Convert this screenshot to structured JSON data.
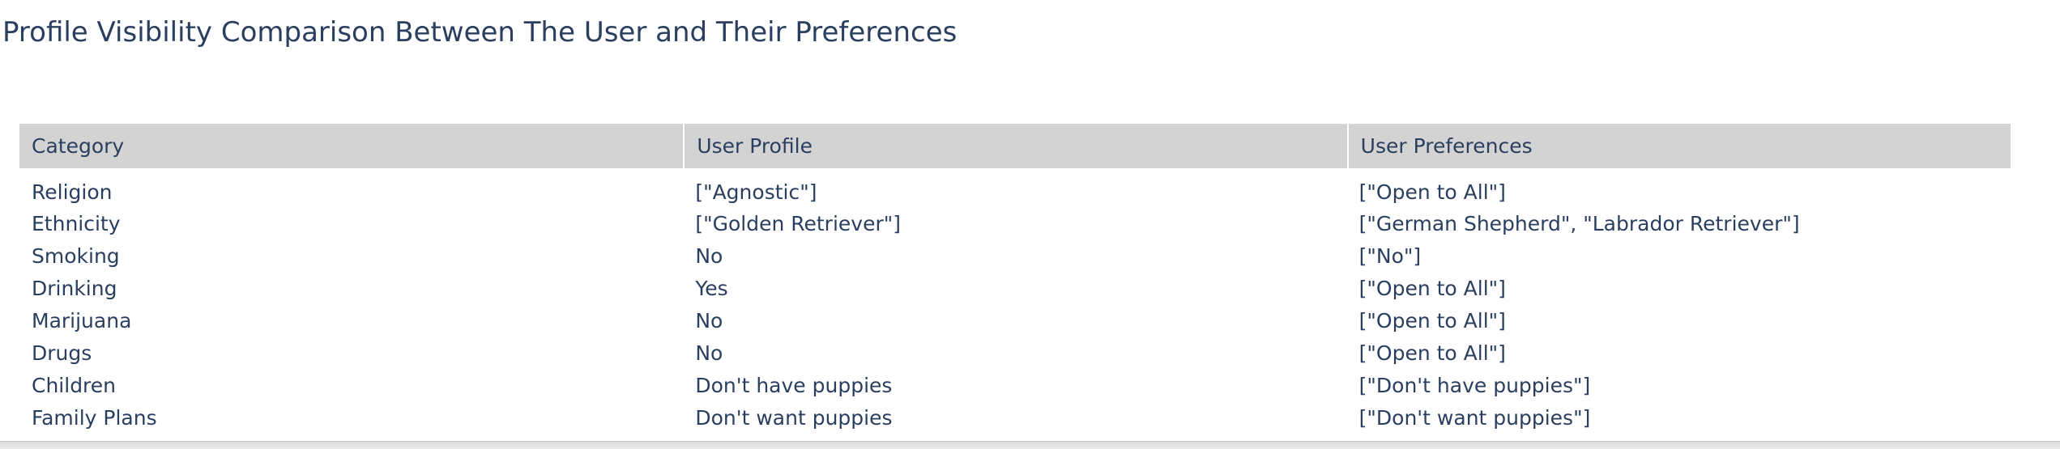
{
  "chart_data": {
    "type": "table",
    "title": "Profile Visibility Comparison Between The User and Their Preferences",
    "columns": [
      "Category",
      "User Profile",
      "User Preferences"
    ],
    "rows": [
      [
        "Religion",
        "[\"Agnostic\"]",
        "[\"Open to All\"]"
      ],
      [
        "Ethnicity",
        "[\"Golden Retriever\"]",
        "[\"German Shepherd\", \"Labrador Retriever\"]"
      ],
      [
        "Smoking",
        "No",
        "[\"No\"]"
      ],
      [
        "Drinking",
        "Yes",
        "[\"Open to All\"]"
      ],
      [
        "Marijuana",
        "No",
        "[\"Open to All\"]"
      ],
      [
        "Drugs",
        "No",
        "[\"Open to All\"]"
      ],
      [
        "Children",
        "Don't have puppies",
        "[\"Don't have puppies\"]"
      ],
      [
        "Family Plans",
        "Don't want puppies",
        "[\"Don't want puppies\"]"
      ]
    ],
    "colors": {
      "header_fill": "#d3d3d3",
      "cell_fill": "#ffffff",
      "text": "#2a3f5f"
    }
  }
}
